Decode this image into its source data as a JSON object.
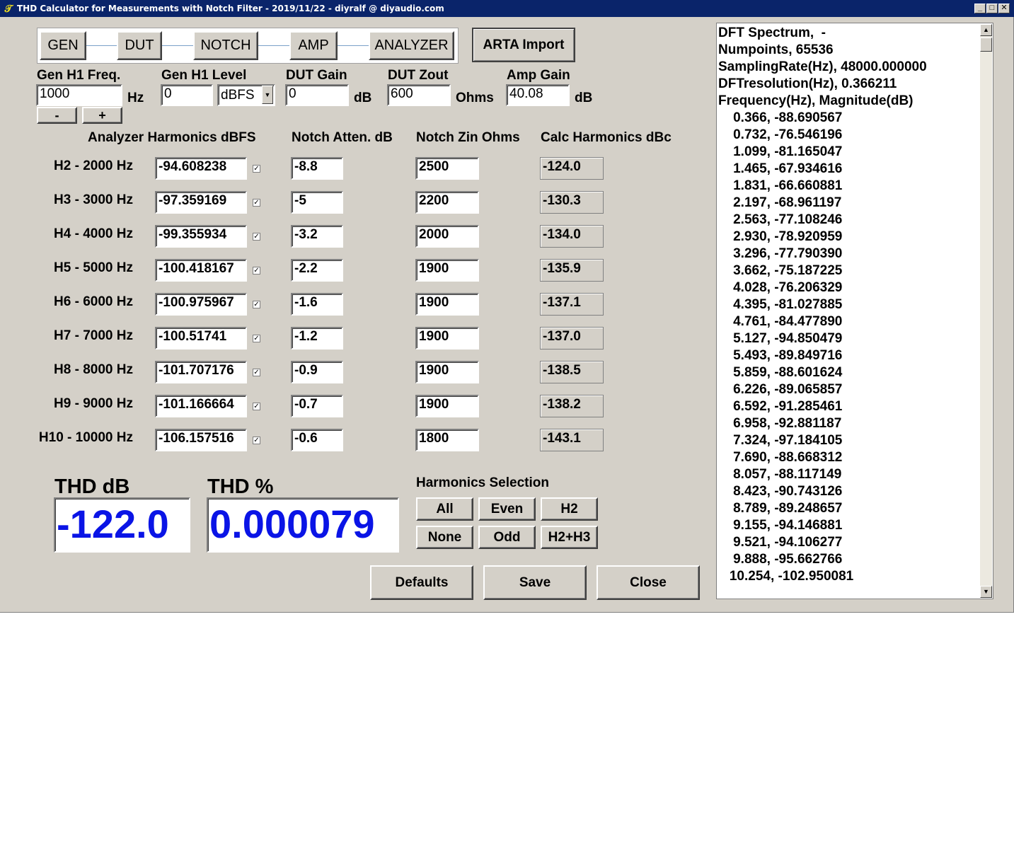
{
  "window": {
    "title": "THD Calculator for Measurements with Notch Filter - 2019/11/22 - diyralf @ diyaudio.com",
    "minimize": "_",
    "maximize": "□",
    "close": "✕"
  },
  "chain": [
    "GEN",
    "DUT",
    "NOTCH",
    "AMP",
    "ANALYZER"
  ],
  "arta_import": "ARTA Import",
  "params": {
    "gen_freq": {
      "label": "Gen H1 Freq.",
      "value": "1000",
      "unit": "Hz"
    },
    "gen_level": {
      "label": "Gen H1 Level",
      "value": "0",
      "unit_selected": "dBFS"
    },
    "dut_gain": {
      "label": "DUT Gain",
      "value": "0",
      "unit": "dB"
    },
    "dut_zout": {
      "label": "DUT Zout",
      "value": "600",
      "unit": "Ohms"
    },
    "amp_gain": {
      "label": "Amp Gain",
      "value": "40.08",
      "unit": "dB"
    },
    "minus": "-",
    "plus": "+"
  },
  "headers": {
    "analyzer": "Analyzer Harmonics dBFS",
    "notch_atten": "Notch Atten. dB",
    "notch_zin": "Notch Zin Ohms",
    "calc": "Calc Harmonics dBc"
  },
  "harmonics": [
    {
      "label": "H2 - 2000 Hz",
      "analyzer": "-94.608238",
      "atten": "-8.8",
      "zin": "2500",
      "calc": "-124.0"
    },
    {
      "label": "H3 - 3000 Hz",
      "analyzer": "-97.359169",
      "atten": "-5",
      "zin": "2200",
      "calc": "-130.3"
    },
    {
      "label": "H4 - 4000 Hz",
      "analyzer": "-99.355934",
      "atten": "-3.2",
      "zin": "2000",
      "calc": "-134.0"
    },
    {
      "label": "H5 - 5000 Hz",
      "analyzer": "-100.418167",
      "atten": "-2.2",
      "zin": "1900",
      "calc": "-135.9"
    },
    {
      "label": "H6 - 6000 Hz",
      "analyzer": "-100.975967",
      "atten": "-1.6",
      "zin": "1900",
      "calc": "-137.1"
    },
    {
      "label": "H7 - 7000 Hz",
      "analyzer": "-100.51741",
      "atten": "-1.2",
      "zin": "1900",
      "calc": "-137.0"
    },
    {
      "label": "H8 - 8000 Hz",
      "analyzer": "-101.707176",
      "atten": "-0.9",
      "zin": "1900",
      "calc": "-138.5"
    },
    {
      "label": "H9 - 9000 Hz",
      "analyzer": "-101.166664",
      "atten": "-0.7",
      "zin": "1900",
      "calc": "-138.2"
    },
    {
      "label": "H10 - 10000 Hz",
      "analyzer": "-106.157516",
      "atten": "-0.6",
      "zin": "1800",
      "calc": "-143.1"
    }
  ],
  "check_mark": "✓",
  "thd": {
    "db_label": "THD dB",
    "db_value": "-122.0",
    "pct_label": "THD %",
    "pct_value": "0.000079"
  },
  "selection": {
    "label": "Harmonics Selection",
    "buttons": [
      "All",
      "Even",
      "H2",
      "None",
      "Odd",
      "H2+H3"
    ]
  },
  "actions": {
    "defaults": "Defaults",
    "save": "Save",
    "close": "Close"
  },
  "spectrum": {
    "header": [
      "DFT Spectrum,  -",
      "Numpoints, 65536",
      "SamplingRate(Hz), 48000.000000",
      "DFTresolution(Hz), 0.366211",
      "Frequency(Hz), Magnitude(dB)"
    ],
    "rows": [
      "    0.366, -88.690567",
      "    0.732, -76.546196",
      "    1.099, -81.165047",
      "    1.465, -67.934616",
      "    1.831, -66.660881",
      "    2.197, -68.961197",
      "    2.563, -77.108246",
      "    2.930, -78.920959",
      "    3.296, -77.790390",
      "    3.662, -75.187225",
      "    4.028, -76.206329",
      "    4.395, -81.027885",
      "    4.761, -84.477890",
      "    5.127, -94.850479",
      "    5.493, -89.849716",
      "    5.859, -88.601624",
      "    6.226, -89.065857",
      "    6.592, -91.285461",
      "    6.958, -92.881187",
      "    7.324, -97.184105",
      "    7.690, -88.668312",
      "    8.057, -88.117149",
      "    8.423, -90.743126",
      "    8.789, -89.248657",
      "    9.155, -94.146881",
      "    9.521, -94.106277",
      "    9.888, -95.662766",
      "   10.254, -102.950081"
    ],
    "scroll_up": "▲",
    "scroll_down": "▼"
  }
}
